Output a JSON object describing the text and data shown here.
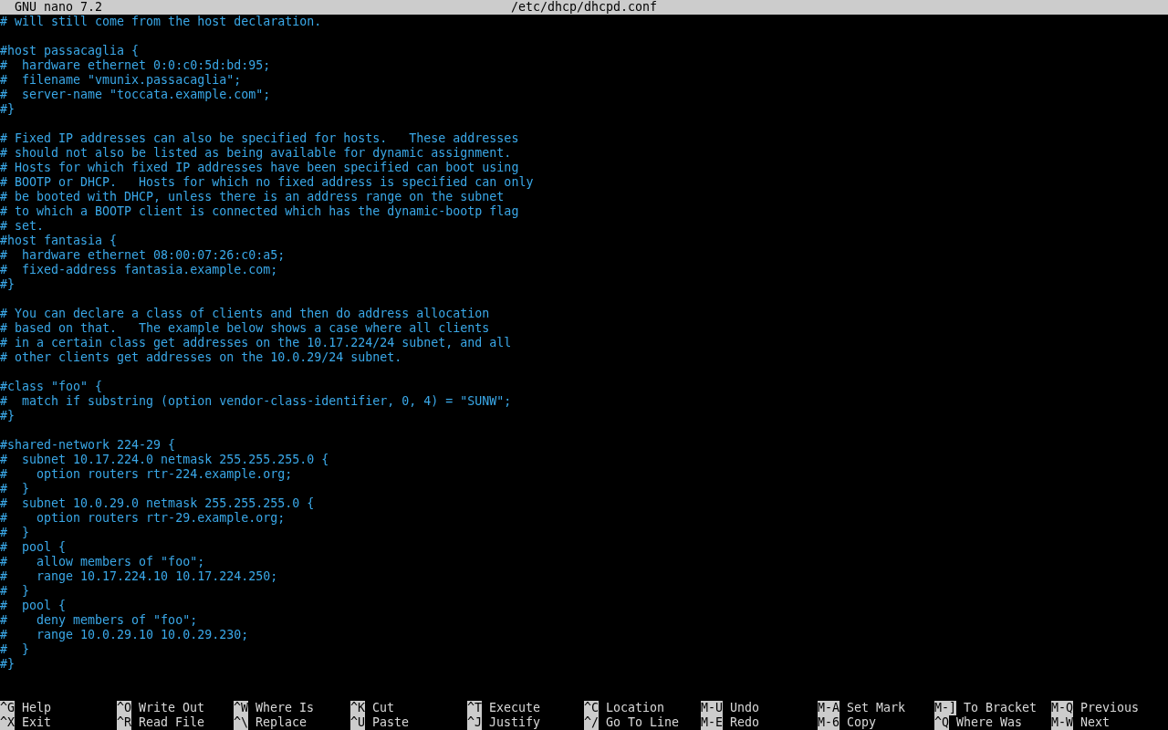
{
  "title_bar": {
    "app": "GNU nano 7.2",
    "filename": "/etc/dhcp/dhcpd.conf"
  },
  "lines": [
    {
      "kind": "text",
      "text": "# will still come from the host declaration."
    },
    {
      "kind": "blank"
    },
    {
      "kind": "text",
      "text": "#host passacaglia {"
    },
    {
      "kind": "text",
      "text": "#  hardware ethernet 0:0:c0:5d:bd:95;"
    },
    {
      "kind": "text",
      "text": "#  filename \"vmunix.passacaglia\";"
    },
    {
      "kind": "text",
      "text": "#  server-name \"toccata.example.com\";"
    },
    {
      "kind": "text",
      "text": "#}"
    },
    {
      "kind": "blank"
    },
    {
      "kind": "text",
      "text": "# Fixed IP addresses can also be specified for hosts.   These addresses"
    },
    {
      "kind": "text",
      "text": "# should not also be listed as being available for dynamic assignment."
    },
    {
      "kind": "text",
      "text": "# Hosts for which fixed IP addresses have been specified can boot using"
    },
    {
      "kind": "text",
      "text": "# BOOTP or DHCP.   Hosts for which no fixed address is specified can only"
    },
    {
      "kind": "text",
      "text": "# be booted with DHCP, unless there is an address range on the subnet"
    },
    {
      "kind": "text",
      "text": "# to which a BOOTP client is connected which has the dynamic-bootp flag"
    },
    {
      "kind": "text",
      "text": "# set."
    },
    {
      "kind": "text",
      "text": "#host fantasia {"
    },
    {
      "kind": "text",
      "text": "#  hardware ethernet 08:00:07:26:c0:a5;"
    },
    {
      "kind": "text",
      "text": "#  fixed-address fantasia.example.com;"
    },
    {
      "kind": "text",
      "text": "#}"
    },
    {
      "kind": "blank"
    },
    {
      "kind": "text",
      "text": "# You can declare a class of clients and then do address allocation"
    },
    {
      "kind": "text",
      "text": "# based on that.   The example below shows a case where all clients"
    },
    {
      "kind": "text",
      "text": "# in a certain class get addresses on the 10.17.224/24 subnet, and all"
    },
    {
      "kind": "text",
      "text": "# other clients get addresses on the 10.0.29/24 subnet."
    },
    {
      "kind": "blank"
    },
    {
      "kind": "text",
      "text": "#class \"foo\" {"
    },
    {
      "kind": "text",
      "text": "#  match if substring (option vendor-class-identifier, 0, 4) = \"SUNW\";"
    },
    {
      "kind": "text",
      "text": "#}"
    },
    {
      "kind": "blank"
    },
    {
      "kind": "text",
      "text": "#shared-network 224-29 {"
    },
    {
      "kind": "text",
      "text": "#  subnet 10.17.224.0 netmask 255.255.255.0 {"
    },
    {
      "kind": "text",
      "text": "#    option routers rtr-224.example.org;"
    },
    {
      "kind": "text",
      "text": "#  }"
    },
    {
      "kind": "text",
      "text": "#  subnet 10.0.29.0 netmask 255.255.255.0 {"
    },
    {
      "kind": "text",
      "text": "#    option routers rtr-29.example.org;"
    },
    {
      "kind": "text",
      "text": "#  }"
    },
    {
      "kind": "text",
      "text": "#  pool {"
    },
    {
      "kind": "text",
      "text": "#    allow members of \"foo\";"
    },
    {
      "kind": "text",
      "text": "#    range 10.17.224.10 10.17.224.250;"
    },
    {
      "kind": "text",
      "text": "#  }"
    },
    {
      "kind": "text",
      "text": "#  pool {"
    },
    {
      "kind": "text",
      "text": "#    deny members of \"foo\";"
    },
    {
      "kind": "text",
      "text": "#    range 10.0.29.10 10.0.29.230;"
    },
    {
      "kind": "text",
      "text": "#  }"
    },
    {
      "kind": "text",
      "text": "#}"
    }
  ],
  "shortcuts": [
    {
      "key": "^G",
      "label": "Help"
    },
    {
      "key": "^O",
      "label": "Write Out"
    },
    {
      "key": "^W",
      "label": "Where Is"
    },
    {
      "key": "^K",
      "label": "Cut"
    },
    {
      "key": "^T",
      "label": "Execute"
    },
    {
      "key": "^C",
      "label": "Location"
    },
    {
      "key": "M-U",
      "label": "Undo"
    },
    {
      "key": "M-A",
      "label": "Set Mark"
    },
    {
      "key": "M-]",
      "label": "To Bracket"
    },
    {
      "key": "M-Q",
      "label": "Previous"
    },
    {
      "key": "^X",
      "label": "Exit"
    },
    {
      "key": "^R",
      "label": "Read File"
    },
    {
      "key": "^\\",
      "label": "Replace"
    },
    {
      "key": "^U",
      "label": "Paste"
    },
    {
      "key": "^J",
      "label": "Justify"
    },
    {
      "key": "^/",
      "label": "Go To Line"
    },
    {
      "key": "M-E",
      "label": "Redo"
    },
    {
      "key": "M-6",
      "label": "Copy"
    },
    {
      "key": "^Q",
      "label": "Where Was"
    },
    {
      "key": "M-W",
      "label": "Next"
    }
  ]
}
